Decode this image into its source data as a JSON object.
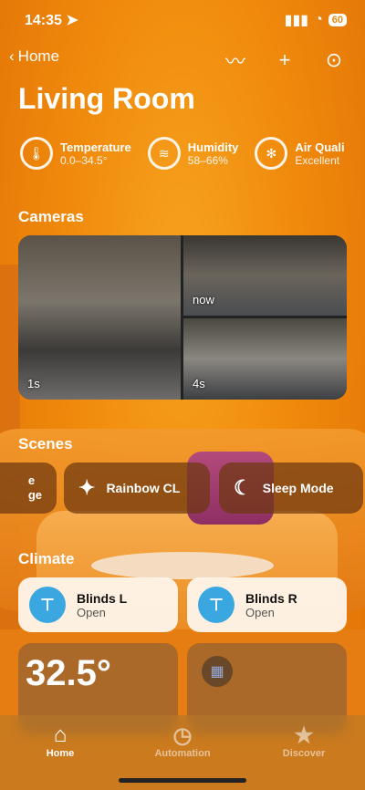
{
  "status": {
    "time": "14:35",
    "battery": "60"
  },
  "nav": {
    "back_label": "Home"
  },
  "title": "Living Room",
  "sensors": [
    {
      "name": "Temperature",
      "value": "0.0–34.5°",
      "icon": "thermometer-icon"
    },
    {
      "name": "Humidity",
      "value": "58–66%",
      "icon": "humidity-icon"
    },
    {
      "name": "Air Quali",
      "value": "Excellent",
      "icon": "air-quality-icon"
    }
  ],
  "sections": {
    "cameras": "Cameras",
    "scenes": "Scenes",
    "climate": "Climate"
  },
  "cameras": [
    {
      "label": "1s"
    },
    {
      "label": "now"
    },
    {
      "label": "4s"
    }
  ],
  "scenes": [
    {
      "label": "e\nge"
    },
    {
      "label": "Rainbow CL",
      "icon": "dance-icon"
    },
    {
      "label": "Sleep Mode",
      "icon": "moon-icon"
    }
  ],
  "climate": [
    {
      "name": "Blinds L",
      "state": "Open",
      "icon": "blinds-icon"
    },
    {
      "name": "Blinds R",
      "state": "Open",
      "icon": "blinds-icon"
    }
  ],
  "big_tile": {
    "temp": "32.5°"
  },
  "tabs": [
    {
      "label": "Home",
      "icon": "house-icon"
    },
    {
      "label": "Automation",
      "icon": "clock-icon"
    },
    {
      "label": "Discover",
      "icon": "star-icon"
    }
  ]
}
